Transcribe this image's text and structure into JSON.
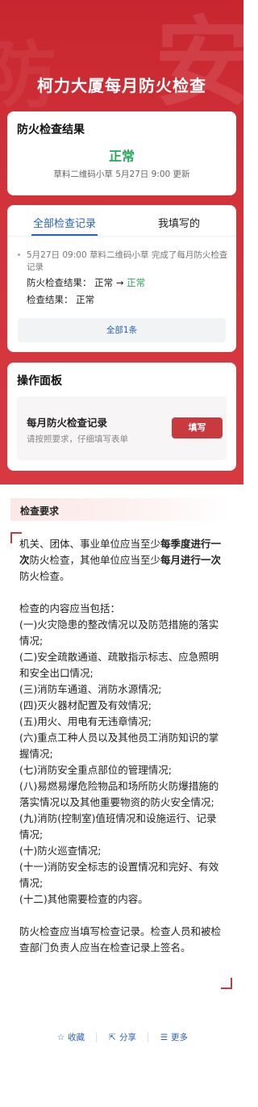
{
  "header": {
    "title": "柯力大厦每月防火检查"
  },
  "result_card": {
    "title": "防火检查结果",
    "status": "正常",
    "meta": "草料二维码小草 5月27日 9:00 更新"
  },
  "records": {
    "tabs": [
      "全部检查记录",
      "我填写的"
    ],
    "entry": {
      "line": "5月27日 09:00  草料二维码小草 完成了每月防火检查记录",
      "field1_label": "防火检查结果：",
      "field1_old": "正常",
      "field1_arrow": "→",
      "field1_new": "正常",
      "field2_label": "检查结果：",
      "field2_value": "正常"
    },
    "all_button": "全部1条"
  },
  "panel": {
    "title": "操作面板",
    "item_title": "每月防火检查记录",
    "item_sub": "请按照要求，仔细填写表单",
    "fill_button": "填写"
  },
  "requirements": {
    "header": "检查要求",
    "p1_a": "机关、团体、事业单位应当至少",
    "p1_b": "每季度进行一次",
    "p1_c": "防火检查，其他单位应当至少",
    "p1_d": "每月进行一次",
    "p1_e": "防火检查。",
    "intro": "检查的内容应当包括：",
    "items": [
      "(一)火灾隐患的整改情况以及防范措施的落实情况;",
      "(二)安全疏散通道、疏散指示标志、应急照明和安全出口情况;",
      "(三)消防车通道、消防水源情况;",
      "(四)灭火器材配置及有效情况;",
      "(五)用火、用电有无违章情况;",
      "(六)重点工种人员以及其他员工消防知识的掌握情况;",
      "(七)消防安全重点部位的管理情况;",
      "(八)易燃易爆危险物品和场所防火防爆措施的落实情况以及其他重要物资的防火安全情况;",
      "(九)消防(控制室)值班情况和设施运行、记录情况;",
      "(十)防火巡查情况;",
      "(十一)消防安全标志的设置情况和完好、有效情况;",
      "(十二)其他需要检查的内容。"
    ],
    "closing": "防火检查应当填写检查记录。检查人员和被检查部门负责人应当在检查记录上签名。"
  },
  "footer": {
    "collect": "收藏",
    "share": "分享",
    "more": "更多"
  }
}
